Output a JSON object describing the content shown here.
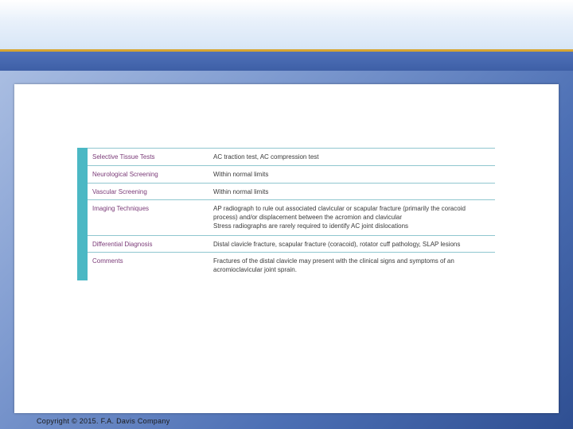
{
  "slide": {
    "table": {
      "rows": [
        {
          "label": "Selective Tissue Tests",
          "lines": [
            "AC traction test, AC compression test"
          ]
        },
        {
          "label": "Neurological Screening",
          "lines": [
            "Within normal limits"
          ]
        },
        {
          "label": "Vascular Screening",
          "lines": [
            "Within normal limits"
          ]
        },
        {
          "label": "Imaging Techniques",
          "lines": [
            "AP radiograph to rule out associated clavicular or scapular fracture (primarily the coracoid",
            "process) and/or displacement between the acromion and clavicular"
          ],
          "extra": "Stress radiographs are rarely required to identify AC joint dislocations"
        },
        {
          "label": "Differential Diagnosis",
          "lines": [
            "Distal clavicle fracture, scapular fracture (coracoid), rotator cuff pathology, SLAP lesions"
          ]
        },
        {
          "label": "Comments",
          "lines": [
            "Fractures of the distal clavicle may present with the clinical signs and symptoms of an",
            "acromioclavicular joint sprain."
          ]
        }
      ]
    },
    "copyright": "Copyright © 2015. F.A. Davis Company"
  },
  "colors": {
    "label_text": "#7b3b78",
    "accent_strip": "#4bb8c4",
    "rule_line": "#8fc6cf",
    "header_gold": "#d7a531"
  }
}
